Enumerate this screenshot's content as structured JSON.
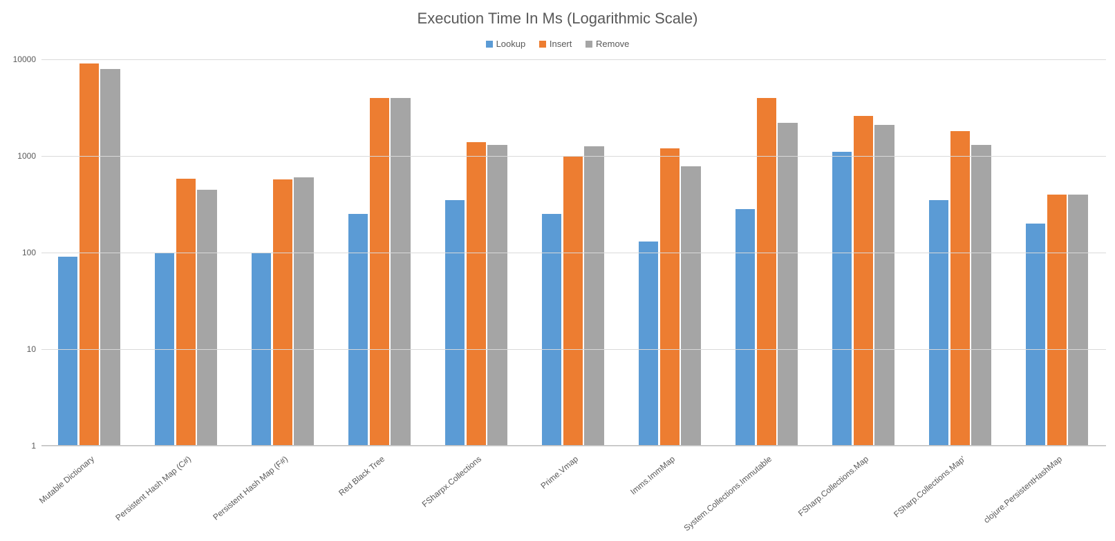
{
  "chart_data": {
    "type": "bar",
    "title": "Execution Time In Ms (Logarithmic Scale)",
    "xlabel": "",
    "ylabel": "",
    "yscale": "log",
    "ylim": [
      1,
      10000
    ],
    "yticks": [
      1,
      10,
      100,
      1000,
      10000
    ],
    "categories": [
      "Mutable Dictionary",
      "Persistent Hash Map (C#)",
      "Persistent Hash Map (F#)",
      "Red Black Tree",
      "FSharpx.Collections",
      "Prime.Vmap",
      "Imms.ImmMap",
      "System.Collections.Immutable",
      "FSharp.Collections.Map",
      "FSharp.Collections.Map'",
      "clojure.PersistentHashMap"
    ],
    "series": [
      {
        "name": "Lookup",
        "color": "#5B9BD5",
        "values": [
          90,
          100,
          100,
          250,
          350,
          250,
          130,
          280,
          1100,
          350,
          200
        ]
      },
      {
        "name": "Insert",
        "color": "#ED7D31",
        "values": [
          9000,
          580,
          570,
          4000,
          1400,
          1000,
          1200,
          4000,
          2600,
          1800,
          400
        ]
      },
      {
        "name": "Remove",
        "color": "#A5A5A5",
        "values": [
          8000,
          450,
          600,
          4000,
          1300,
          1250,
          780,
          2200,
          2100,
          1300,
          400
        ]
      }
    ],
    "legend_position": "top"
  }
}
